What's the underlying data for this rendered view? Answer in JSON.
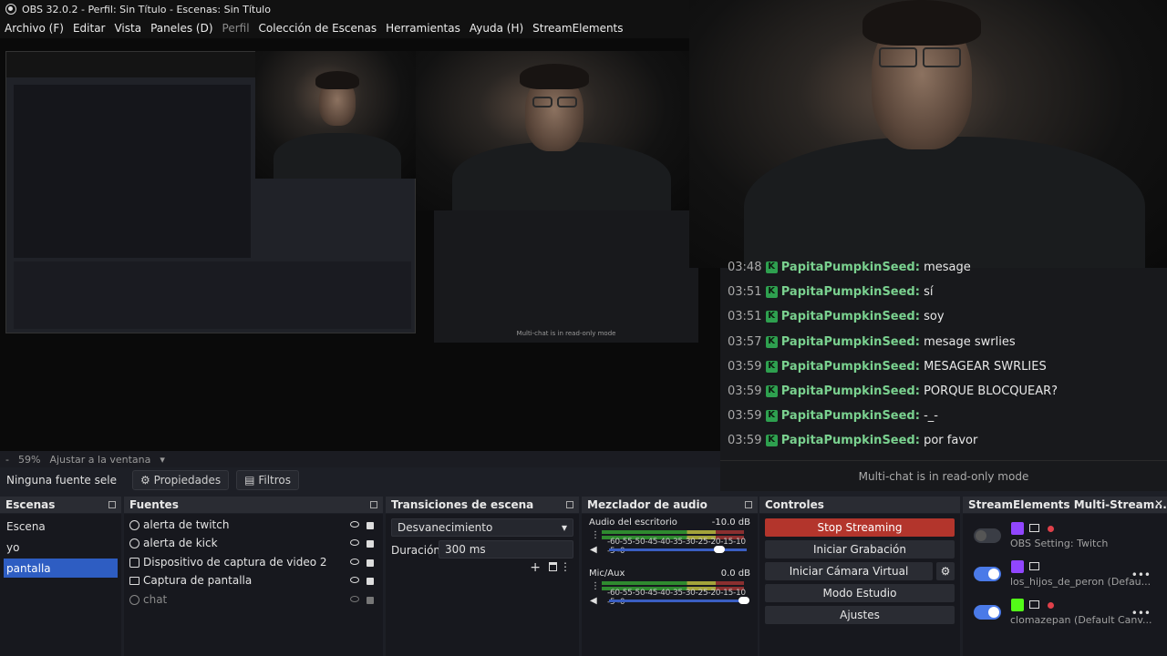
{
  "window": {
    "title": "OBS 32.0.2 - Perfil: Sin Título - Escenas: Sin Título"
  },
  "menu": [
    {
      "label": "Archivo (F)",
      "dim": false
    },
    {
      "label": "Editar",
      "dim": false
    },
    {
      "label": "Vista",
      "dim": false
    },
    {
      "label": "Paneles (D)",
      "dim": false
    },
    {
      "label": "Perfil",
      "dim": true
    },
    {
      "label": "Colección de Escenas",
      "dim": false
    },
    {
      "label": "Herramientas",
      "dim": false
    },
    {
      "label": "Ayuda (H)",
      "dim": false
    },
    {
      "label": "StreamElements",
      "dim": false
    }
  ],
  "chat": {
    "messages": [
      {
        "time": "03:48",
        "user": "PapitaPumpkinSeed:",
        "text": "mesage"
      },
      {
        "time": "03:51",
        "user": "PapitaPumpkinSeed:",
        "text": "sí"
      },
      {
        "time": "03:51",
        "user": "PapitaPumpkinSeed:",
        "text": "soy"
      },
      {
        "time": "03:57",
        "user": "PapitaPumpkinSeed:",
        "text": "mesage swrlies"
      },
      {
        "time": "03:59",
        "user": "PapitaPumpkinSeed:",
        "text": "MESAGEAR SWRLIES"
      },
      {
        "time": "03:59",
        "user": "PapitaPumpkinSeed:",
        "text": "PORQUE BLOCQUEAR?"
      },
      {
        "time": "03:59",
        "user": "PapitaPumpkinSeed:",
        "text": "-_-"
      },
      {
        "time": "03:59",
        "user": "PapitaPumpkinSeed:",
        "text": "por favor"
      }
    ],
    "footer": "Multi-chat is in read-only mode"
  },
  "zoombar": {
    "zoom": "59%",
    "fit": "Ajustar a la ventana"
  },
  "source_toolbar": {
    "none": "Ninguna fuente sele",
    "properties": "Propiedades",
    "filters": "Filtros"
  },
  "scenes": {
    "title": "Escenas",
    "items": [
      {
        "label": "Escena",
        "selected": false
      },
      {
        "label": "yo",
        "selected": false
      },
      {
        "label": "pantalla",
        "selected": true
      }
    ]
  },
  "sources": {
    "title": "Fuentes",
    "items": [
      {
        "label": "alerta de twitch",
        "icon": "browser-icon",
        "dim": false
      },
      {
        "label": "alerta de kick",
        "icon": "browser-icon",
        "dim": false
      },
      {
        "label": "Dispositivo de captura de video 2",
        "icon": "camera-icon",
        "dim": false
      },
      {
        "label": "Captura de pantalla",
        "icon": "monitor-icon",
        "dim": false
      },
      {
        "label": "chat",
        "icon": "browser-icon",
        "dim": true
      }
    ]
  },
  "transitions": {
    "title": "Transiciones de escena",
    "selected": "Desvanecimiento",
    "duration_label": "Duración",
    "duration_value": "300 ms"
  },
  "mixer": {
    "title": "Mezclador de audio",
    "scale": "-60-55-50-45-40-35-30-25-20-15-10 -5 -0",
    "tracks": [
      {
        "name": "Audio del escritorio",
        "level": "-10.0 dB",
        "volume": 0.8,
        "meter": 0.72
      },
      {
        "name": "Mic/Aux",
        "level": "0.0 dB",
        "volume": 0.98,
        "meter": 0.62
      }
    ]
  },
  "controls": {
    "title": "Controles",
    "stop_streaming": "Stop Streaming",
    "start_recording": "Iniciar Grabación",
    "virtual_cam": "Iniciar Cámara Virtual",
    "studio_mode": "Modo Estudio",
    "settings": "Ajustes"
  },
  "streamelements": {
    "title": "StreamElements Multi-Stream...",
    "outputs": [
      {
        "name": "OBS Setting: Twitch",
        "on": false,
        "platform": "twitch-icon",
        "color": "#9146ff"
      },
      {
        "name": "los_hijos_de_peron (Defau...",
        "on": true,
        "platform": "twitch-icon",
        "color": "#9146ff"
      },
      {
        "name": "clomazepan (Default Canv...",
        "on": true,
        "platform": "kick-icon",
        "color": "#53fc18"
      }
    ]
  }
}
